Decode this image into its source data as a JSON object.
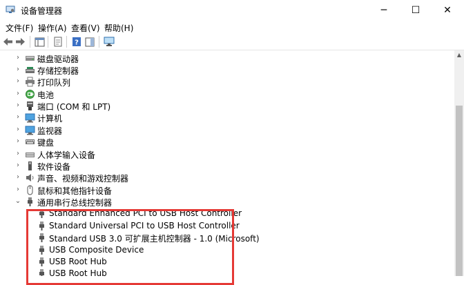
{
  "window": {
    "title": "设备管理器",
    "minimize": "─",
    "maximize": "☐",
    "close": "✕"
  },
  "menu": [
    "文件(F)",
    "操作(A)",
    "查看(V)",
    "帮助(H)"
  ],
  "tree": {
    "categories": [
      {
        "label": "磁盘驱动器",
        "icon": "disk-drive-icon",
        "expanded": false
      },
      {
        "label": "存储控制器",
        "icon": "storage-controller-icon",
        "expanded": false
      },
      {
        "label": "打印队列",
        "icon": "printer-icon",
        "expanded": false
      },
      {
        "label": "电池",
        "icon": "battery-icon",
        "expanded": false
      },
      {
        "label": "端口 (COM 和 LPT)",
        "icon": "port-icon",
        "expanded": false
      },
      {
        "label": "计算机",
        "icon": "computer-icon",
        "expanded": false
      },
      {
        "label": "监视器",
        "icon": "monitor-icon",
        "expanded": false
      },
      {
        "label": "键盘",
        "icon": "keyboard-icon",
        "expanded": false
      },
      {
        "label": "人体学输入设备",
        "icon": "hid-icon",
        "expanded": false
      },
      {
        "label": "软件设备",
        "icon": "software-device-icon",
        "expanded": false
      },
      {
        "label": "声音、视频和游戏控制器",
        "icon": "audio-icon",
        "expanded": false
      },
      {
        "label": "鼠标和其他指针设备",
        "icon": "mouse-icon",
        "expanded": false
      },
      {
        "label": "通用串行总线控制器",
        "icon": "usb-icon",
        "expanded": true
      }
    ],
    "usb_children": [
      "Standard Enhanced PCI to USB Host Controller",
      "Standard Universal PCI to USB Host Controller",
      "Standard USB 3.0 可扩展主机控制器 - 1.0 (Microsoft)",
      "USB Composite Device",
      "USB Root Hub",
      "USB Root Hub"
    ]
  },
  "colors": {
    "highlight": "#e53935",
    "selection_accent": "#0078d7"
  }
}
